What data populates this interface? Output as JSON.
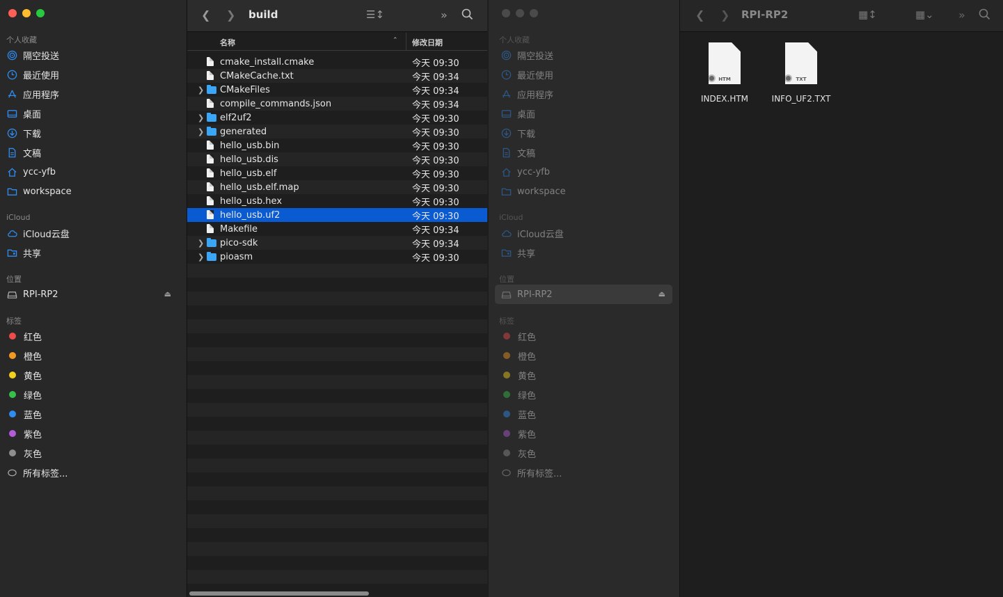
{
  "win1": {
    "title": "build",
    "sidebar": {
      "favorites_header": "个人收藏",
      "favorites": [
        {
          "label": "隔空投送",
          "icon": "airdrop-icon"
        },
        {
          "label": "最近使用",
          "icon": "clock-icon"
        },
        {
          "label": "应用程序",
          "icon": "applications-icon"
        },
        {
          "label": "桌面",
          "icon": "desktop-icon"
        },
        {
          "label": "下载",
          "icon": "download-icon"
        },
        {
          "label": "文稿",
          "icon": "document-icon"
        },
        {
          "label": "ycc-yfb",
          "icon": "home-icon"
        },
        {
          "label": "workspace",
          "icon": "folder-icon"
        }
      ],
      "icloud_header": "iCloud",
      "icloud": [
        {
          "label": "iCloud云盘",
          "icon": "cloud-icon"
        },
        {
          "label": "共享",
          "icon": "shared-folder-icon"
        }
      ],
      "locations_header": "位置",
      "locations": [
        {
          "label": "RPI-RP2",
          "icon": "drive-icon"
        }
      ],
      "tags_header": "标签",
      "tags": [
        {
          "label": "红色",
          "color": "#ee4b4b"
        },
        {
          "label": "橙色",
          "color": "#f39a22"
        },
        {
          "label": "黄色",
          "color": "#f2d21c"
        },
        {
          "label": "绿色",
          "color": "#36c24a"
        },
        {
          "label": "蓝色",
          "color": "#2f8cf0"
        },
        {
          "label": "紫色",
          "color": "#b35bd9"
        },
        {
          "label": "灰色",
          "color": "#8e8e8e"
        }
      ],
      "all_tags": "所有标签..."
    },
    "columns": {
      "name": "名称",
      "date": "修改日期"
    },
    "files": [
      {
        "name": "cmake_install.cmake",
        "date": "今天 09:30",
        "kind": "file"
      },
      {
        "name": "CMakeCache.txt",
        "date": "今天 09:34",
        "kind": "file"
      },
      {
        "name": "CMakeFiles",
        "date": "今天 09:34",
        "kind": "folder"
      },
      {
        "name": "compile_commands.json",
        "date": "今天 09:34",
        "kind": "file"
      },
      {
        "name": "elf2uf2",
        "date": "今天 09:30",
        "kind": "folder"
      },
      {
        "name": "generated",
        "date": "今天 09:30",
        "kind": "folder"
      },
      {
        "name": "hello_usb.bin",
        "date": "今天 09:30",
        "kind": "file"
      },
      {
        "name": "hello_usb.dis",
        "date": "今天 09:30",
        "kind": "file"
      },
      {
        "name": "hello_usb.elf",
        "date": "今天 09:30",
        "kind": "file"
      },
      {
        "name": "hello_usb.elf.map",
        "date": "今天 09:30",
        "kind": "file"
      },
      {
        "name": "hello_usb.hex",
        "date": "今天 09:30",
        "kind": "file"
      },
      {
        "name": "hello_usb.uf2",
        "date": "今天 09:30",
        "kind": "file",
        "selected": true
      },
      {
        "name": "Makefile",
        "date": "今天 09:34",
        "kind": "file"
      },
      {
        "name": "pico-sdk",
        "date": "今天 09:34",
        "kind": "folder"
      },
      {
        "name": "pioasm",
        "date": "今天 09:30",
        "kind": "folder"
      }
    ]
  },
  "win2": {
    "title": "RPI-RP2",
    "items": [
      {
        "name": "INDEX.HTM",
        "ext": "HTM"
      },
      {
        "name": "INFO_UF2.TXT",
        "ext": "TXT"
      }
    ]
  },
  "colors": {
    "accent": "#0a5bd1",
    "close": "#fe5f57",
    "minimize": "#febc2e",
    "zoom": "#28c840"
  }
}
